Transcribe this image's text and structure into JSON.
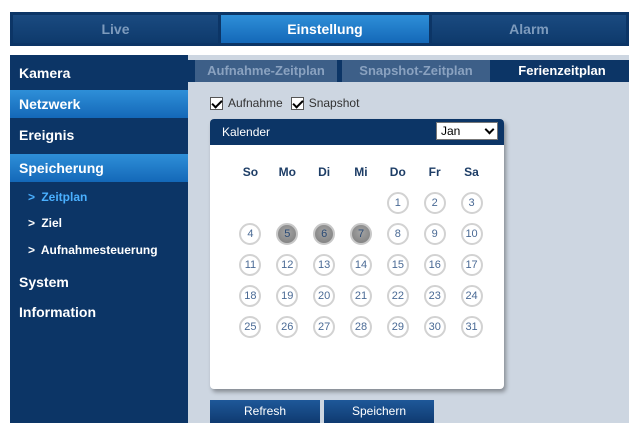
{
  "topnav": {
    "tabs": [
      {
        "label": "Live"
      },
      {
        "label": "Einstellung"
      },
      {
        "label": "Alarm"
      }
    ]
  },
  "sidebar": {
    "items": [
      {
        "label": "Kamera"
      },
      {
        "label": "Netzwerk"
      },
      {
        "label": "Ereignis"
      },
      {
        "label": "Speicherung"
      },
      {
        "label": "System"
      },
      {
        "label": "Information"
      }
    ],
    "subitems": [
      {
        "label": "Zeitplan"
      },
      {
        "label": "Ziel"
      },
      {
        "label": "Aufnahmesteuerung"
      }
    ]
  },
  "subtabs": [
    {
      "label": "Aufnahme-Zeitplan"
    },
    {
      "label": "Snapshot-Zeitplan"
    },
    {
      "label": "Ferienzeitplan"
    }
  ],
  "checkboxes": [
    {
      "label": "Aufnahme",
      "checked": true
    },
    {
      "label": "Snapshot",
      "checked": true
    }
  ],
  "calendar": {
    "title": "Kalender",
    "month": "Jan",
    "weekdays": [
      "So",
      "Mo",
      "Di",
      "Mi",
      "Do",
      "Fr",
      "Sa"
    ],
    "first_weekday_index": 4,
    "days_in_month": 31,
    "selected_days": [
      5,
      6,
      7
    ]
  },
  "buttons": {
    "refresh": "Refresh",
    "save": "Speichern"
  }
}
